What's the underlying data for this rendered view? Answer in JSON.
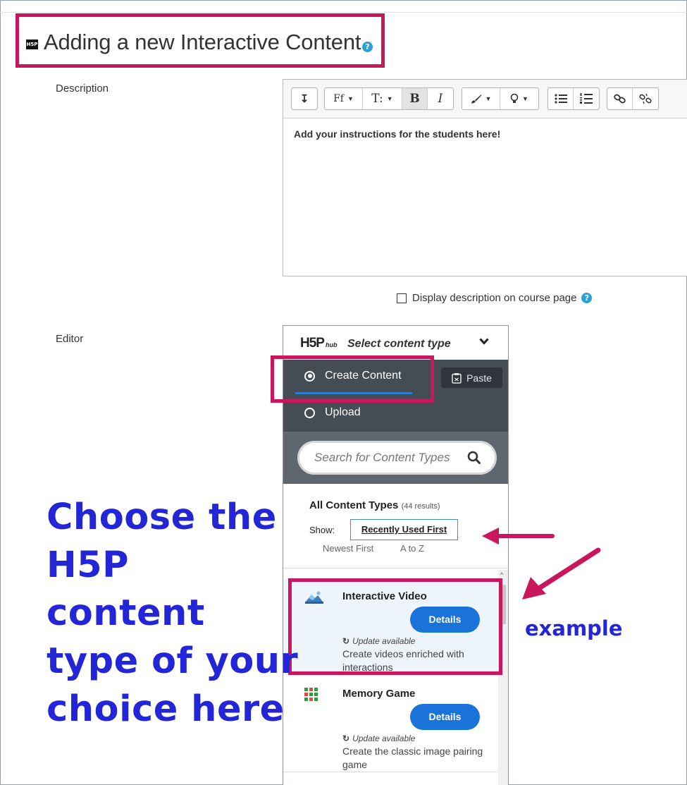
{
  "page": {
    "title": "Adding a new Interactive Content",
    "help_icon": "question-icon",
    "h5p_badge": "H5P"
  },
  "form": {
    "description_label": "Description",
    "editor_label": "Editor",
    "display_description_label": "Display description on course page"
  },
  "editor": {
    "toolbar": {
      "collapse_glyph": "↧",
      "font_family_glyph": "Ff",
      "font_size_glyph": "T:",
      "bold_glyph": "B",
      "italic_glyph": "I",
      "caret_glyph": "▼"
    },
    "content_text": "Add your instructions for the students here!"
  },
  "hub": {
    "logo_main": "H5P",
    "logo_sub": "hub",
    "header_title": "Select content type",
    "tab_create": "Create Content",
    "tab_upload": "Upload",
    "paste_label": "Paste",
    "search_placeholder": "Search for Content Types",
    "all_types_label": "All Content Types",
    "results_count": "(44 results)",
    "show_label": "Show:",
    "sort_options": [
      "Recently Used First",
      "Newest First",
      "A to Z"
    ],
    "scroll_up_glyph": "^",
    "items": [
      {
        "name": "Interactive Video",
        "button": "Details",
        "update_glyph": "↻",
        "update": "Update available",
        "description": "Create videos enriched with interactions",
        "icon": "interactive-video-icon"
      },
      {
        "name": "Memory Game",
        "button": "Details",
        "update_glyph": "↻",
        "update": "Update available",
        "description": "Create the classic image pairing game",
        "icon": "memory-game-icon"
      }
    ]
  },
  "annotations": {
    "big_note_lines": [
      "Choose the",
      "H5P",
      "content",
      "type of your",
      "choice here"
    ],
    "example_label": "example",
    "highlight_color": "#c8175d",
    "text_color": "#2326d6"
  },
  "colors": {
    "hub_tabs_bg": "#444c54",
    "hub_search_bg": "#5e6770",
    "details_button": "#1a73d9",
    "help_icon": "#2b9fd6"
  }
}
